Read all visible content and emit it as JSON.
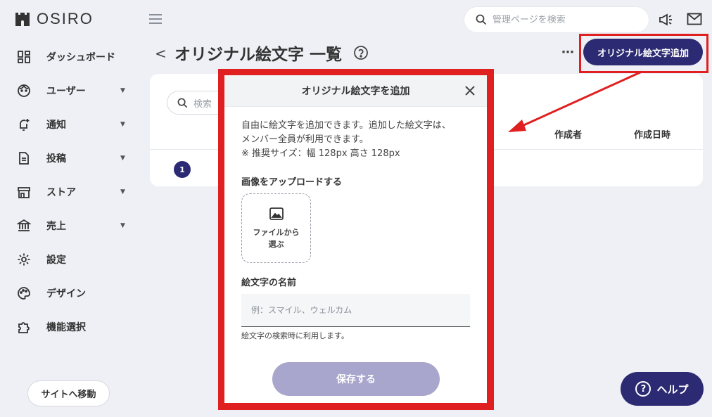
{
  "brand": {
    "name": "OSIRO"
  },
  "sidebar": {
    "items": [
      {
        "label": "ダッシュボード",
        "icon": "dashboard-icon",
        "has_caret": false
      },
      {
        "label": "ユーザー",
        "icon": "user-face-icon",
        "has_caret": true
      },
      {
        "label": "通知",
        "icon": "bell-plus-icon",
        "has_caret": true
      },
      {
        "label": "投稿",
        "icon": "document-icon",
        "has_caret": true
      },
      {
        "label": "ストア",
        "icon": "store-icon",
        "has_caret": true
      },
      {
        "label": "売上",
        "icon": "bank-icon",
        "has_caret": true
      },
      {
        "label": "設定",
        "icon": "gear-icon",
        "has_caret": false
      },
      {
        "label": "デザイン",
        "icon": "palette-icon",
        "has_caret": false
      },
      {
        "label": "機能選択",
        "icon": "puzzle-icon",
        "has_caret": false
      }
    ],
    "caret": "▼",
    "site_button": "サイトへ移動"
  },
  "topbar": {
    "search_placeholder": "管理ページを検索"
  },
  "header": {
    "back": "<",
    "title": "オリジナル絵文字 一覧",
    "more": "⋯",
    "add_button": "オリジナル絵文字追加"
  },
  "card": {
    "search_placeholder": "検索",
    "columns": {
      "creator": "作成者",
      "created_at": "作成日時"
    },
    "page": "1"
  },
  "modal": {
    "title": "オリジナル絵文字を追加",
    "desc_line1": "自由に絵文字を追加できます。追加した絵文字は、",
    "desc_line2": "メンバー全員が利用できます。",
    "desc_line3": "※ 推奨サイズ：幅 128px 高さ 128px",
    "upload_label": "画像をアップロードする",
    "upload_button": "ファイルから選ぶ",
    "name_label": "絵文字の名前",
    "name_placeholder": "例：スマイル、ウェルカム",
    "name_hint": "絵文字の検索時に利用します。",
    "save": "保存する"
  },
  "help": {
    "label": "ヘルプ",
    "glyph": "?"
  },
  "colors": {
    "accent": "#2c2a72",
    "annotation": "#e02020",
    "save_disabled": "#a8a6cc",
    "background": "#eef0f5"
  }
}
